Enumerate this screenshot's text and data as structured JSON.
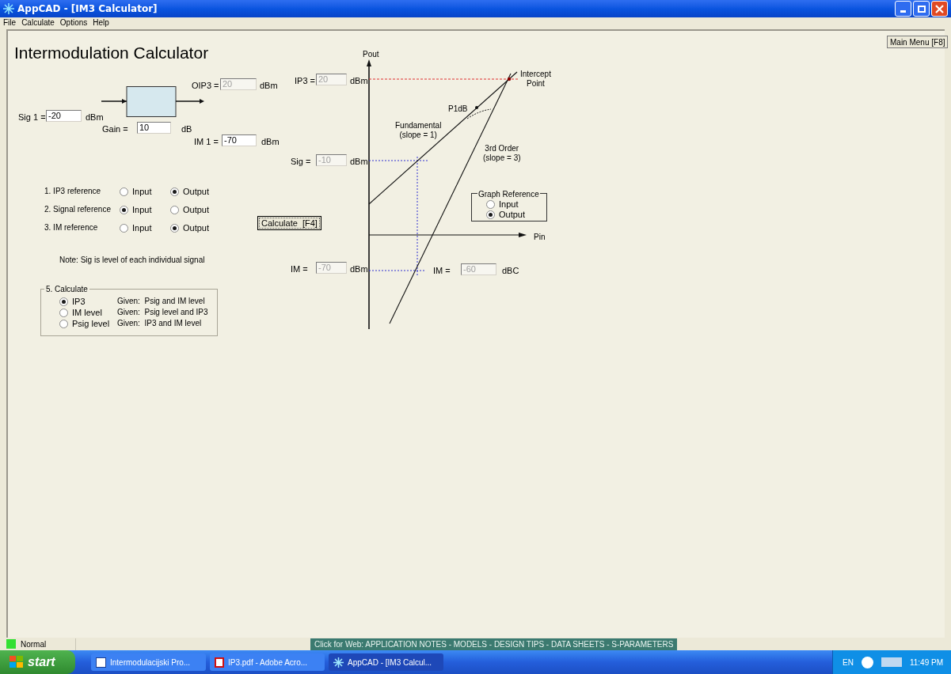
{
  "window": {
    "title": "AppCAD - [IM3 Calculator]"
  },
  "menu": [
    "File",
    "Calculate",
    "Options",
    "Help"
  ],
  "heading": "Intermodulation Calculator",
  "main_menu_button": "Main Menu [F8]",
  "amplifier": {
    "fields": [
      {
        "label": "Sig 1 =",
        "value": "-20",
        "unit": "dBm",
        "disabled": false
      },
      {
        "label": "Gain =",
        "value": "10",
        "unit": "dB",
        "disabled": false
      },
      {
        "label": "OIP3 =",
        "value": "20",
        "unit": "dBm",
        "disabled": true
      },
      {
        "label": "IM 1 =",
        "value": "-70",
        "unit": "dBm",
        "disabled": false
      }
    ]
  },
  "references": [
    {
      "label": "1. IP3 reference",
      "options": [
        {
          "label": "Input",
          "selected": false
        },
        {
          "label": "Output",
          "selected": true
        }
      ]
    },
    {
      "label": "2. Signal reference",
      "options": [
        {
          "label": "Input",
          "selected": true
        },
        {
          "label": "Output",
          "selected": false
        }
      ]
    },
    {
      "label": "3. IM reference",
      "options": [
        {
          "label": "Input",
          "selected": false
        },
        {
          "label": "Output",
          "selected": true
        }
      ]
    }
  ],
  "calculate_button": "Calculate  [F4]",
  "note": "Note: Sig is level of each individual signal",
  "calculate_group": {
    "title": "5. Calculate",
    "options": [
      {
        "label": "IP3",
        "given": "Given:  Psig and IM level",
        "selected": true
      },
      {
        "label": "IM level",
        "given": "Given:  Psig level and IP3",
        "selected": false
      },
      {
        "label": "Psig level",
        "given": "Given:  IP3 and IM level",
        "selected": false
      }
    ]
  },
  "graph": {
    "y_axis": "Pout",
    "x_axis": "Pin",
    "intercept": "Intercept\nPoint",
    "p1db": "P1dB",
    "fundamental": "Fundamental\n(slope = 1)",
    "third_order": "3rd Order\n(slope = 3)",
    "fields": [
      {
        "label": "IP3 =",
        "value": "20",
        "unit": "dBm",
        "disabled": true
      },
      {
        "label": "Sig =",
        "value": "-10",
        "unit": "dBm",
        "disabled": true
      },
      {
        "label": "IM =",
        "value": "-70",
        "unit": "dBm",
        "disabled": true
      },
      {
        "label": "IM =",
        "value": "-60",
        "unit": "dBC",
        "disabled": true
      }
    ],
    "reference": {
      "title": "Graph Reference",
      "options": [
        {
          "label": "Input",
          "selected": false
        },
        {
          "label": "Output",
          "selected": true
        }
      ]
    }
  },
  "status_bar": {
    "mode": "Normal",
    "web_link": "Click for Web: APPLICATION NOTES - MODELS - DESIGN TIPS - DATA SHEETS - S-PARAMETERS"
  },
  "taskbar": {
    "start": "start",
    "tasks": [
      {
        "label": "Intermodulacijski Pro...",
        "kind": "word",
        "selected": false
      },
      {
        "label": "IP3.pdf - Adobe Acro...",
        "kind": "pdf",
        "selected": false
      },
      {
        "label": "AppCAD - [IM3 Calcul...",
        "kind": "appcad",
        "selected": true
      }
    ],
    "language": "EN",
    "clock": "11:49 PM"
  }
}
